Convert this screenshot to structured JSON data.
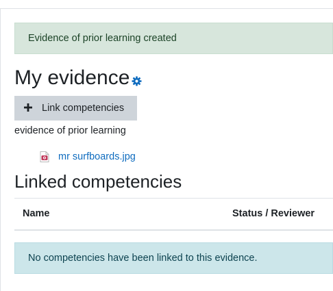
{
  "notification": {
    "success_message": "Evidence of prior learning created"
  },
  "page": {
    "title": "My evidence",
    "settings_icon": "gear-icon"
  },
  "actions": {
    "link_competencies_label": "Link competencies",
    "link_competencies_icon": "plus-icon"
  },
  "evidence": {
    "description": "evidence of prior learning",
    "files": [
      {
        "name": "mr surfboards.jpg",
        "icon": "image-file-icon"
      }
    ]
  },
  "linked": {
    "title": "Linked competencies",
    "columns": [
      "Name",
      "Status / Reviewer"
    ],
    "empty_message": "No competencies have been linked to this evidence."
  },
  "colors": {
    "success_bg": "#d7e6dc",
    "info_bg": "#cce6ea",
    "link": "#0f6cbf",
    "button_bg": "#ced4da",
    "gear": "#0f6cbf"
  }
}
